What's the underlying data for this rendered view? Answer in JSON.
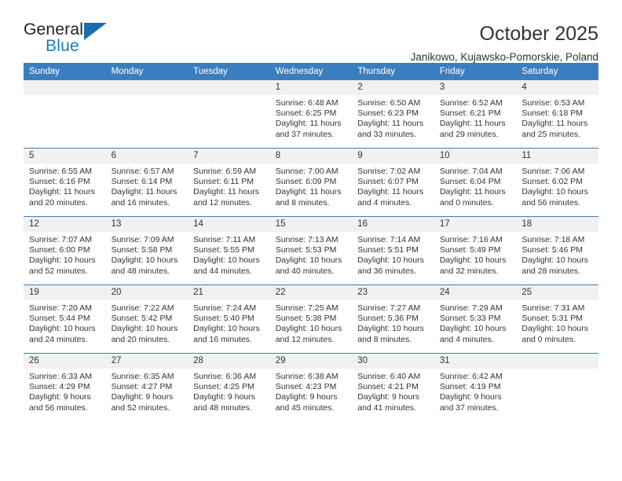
{
  "brand": {
    "name_top": "General",
    "name_bottom": "Blue",
    "accent_color": "#1b7cc4"
  },
  "header": {
    "title": "October 2025",
    "subtitle": "Janikowo, Kujawsko-Pomorskie, Poland"
  },
  "calendar": {
    "header_color": "#3b7ebf",
    "daynum_band_color": "#f1f1f1",
    "weekdays": [
      "Sunday",
      "Monday",
      "Tuesday",
      "Wednesday",
      "Thursday",
      "Friday",
      "Saturday"
    ],
    "weeks": [
      [
        {
          "day": "",
          "empty": true
        },
        {
          "day": "",
          "empty": true
        },
        {
          "day": "",
          "empty": true
        },
        {
          "day": "1",
          "sunrise": "Sunrise: 6:48 AM",
          "sunset": "Sunset: 6:25 PM",
          "daylight_line1": "Daylight: 11 hours",
          "daylight_line2": "and 37 minutes."
        },
        {
          "day": "2",
          "sunrise": "Sunrise: 6:50 AM",
          "sunset": "Sunset: 6:23 PM",
          "daylight_line1": "Daylight: 11 hours",
          "daylight_line2": "and 33 minutes."
        },
        {
          "day": "3",
          "sunrise": "Sunrise: 6:52 AM",
          "sunset": "Sunset: 6:21 PM",
          "daylight_line1": "Daylight: 11 hours",
          "daylight_line2": "and 29 minutes."
        },
        {
          "day": "4",
          "sunrise": "Sunrise: 6:53 AM",
          "sunset": "Sunset: 6:18 PM",
          "daylight_line1": "Daylight: 11 hours",
          "daylight_line2": "and 25 minutes."
        }
      ],
      [
        {
          "day": "5",
          "sunrise": "Sunrise: 6:55 AM",
          "sunset": "Sunset: 6:16 PM",
          "daylight_line1": "Daylight: 11 hours",
          "daylight_line2": "and 20 minutes."
        },
        {
          "day": "6",
          "sunrise": "Sunrise: 6:57 AM",
          "sunset": "Sunset: 6:14 PM",
          "daylight_line1": "Daylight: 11 hours",
          "daylight_line2": "and 16 minutes."
        },
        {
          "day": "7",
          "sunrise": "Sunrise: 6:59 AM",
          "sunset": "Sunset: 6:11 PM",
          "daylight_line1": "Daylight: 11 hours",
          "daylight_line2": "and 12 minutes."
        },
        {
          "day": "8",
          "sunrise": "Sunrise: 7:00 AM",
          "sunset": "Sunset: 6:09 PM",
          "daylight_line1": "Daylight: 11 hours",
          "daylight_line2": "and 8 minutes."
        },
        {
          "day": "9",
          "sunrise": "Sunrise: 7:02 AM",
          "sunset": "Sunset: 6:07 PM",
          "daylight_line1": "Daylight: 11 hours",
          "daylight_line2": "and 4 minutes."
        },
        {
          "day": "10",
          "sunrise": "Sunrise: 7:04 AM",
          "sunset": "Sunset: 6:04 PM",
          "daylight_line1": "Daylight: 11 hours",
          "daylight_line2": "and 0 minutes."
        },
        {
          "day": "11",
          "sunrise": "Sunrise: 7:06 AM",
          "sunset": "Sunset: 6:02 PM",
          "daylight_line1": "Daylight: 10 hours",
          "daylight_line2": "and 56 minutes."
        }
      ],
      [
        {
          "day": "12",
          "sunrise": "Sunrise: 7:07 AM",
          "sunset": "Sunset: 6:00 PM",
          "daylight_line1": "Daylight: 10 hours",
          "daylight_line2": "and 52 minutes."
        },
        {
          "day": "13",
          "sunrise": "Sunrise: 7:09 AM",
          "sunset": "Sunset: 5:58 PM",
          "daylight_line1": "Daylight: 10 hours",
          "daylight_line2": "and 48 minutes."
        },
        {
          "day": "14",
          "sunrise": "Sunrise: 7:11 AM",
          "sunset": "Sunset: 5:55 PM",
          "daylight_line1": "Daylight: 10 hours",
          "daylight_line2": "and 44 minutes."
        },
        {
          "day": "15",
          "sunrise": "Sunrise: 7:13 AM",
          "sunset": "Sunset: 5:53 PM",
          "daylight_line1": "Daylight: 10 hours",
          "daylight_line2": "and 40 minutes."
        },
        {
          "day": "16",
          "sunrise": "Sunrise: 7:14 AM",
          "sunset": "Sunset: 5:51 PM",
          "daylight_line1": "Daylight: 10 hours",
          "daylight_line2": "and 36 minutes."
        },
        {
          "day": "17",
          "sunrise": "Sunrise: 7:16 AM",
          "sunset": "Sunset: 5:49 PM",
          "daylight_line1": "Daylight: 10 hours",
          "daylight_line2": "and 32 minutes."
        },
        {
          "day": "18",
          "sunrise": "Sunrise: 7:18 AM",
          "sunset": "Sunset: 5:46 PM",
          "daylight_line1": "Daylight: 10 hours",
          "daylight_line2": "and 28 minutes."
        }
      ],
      [
        {
          "day": "19",
          "sunrise": "Sunrise: 7:20 AM",
          "sunset": "Sunset: 5:44 PM",
          "daylight_line1": "Daylight: 10 hours",
          "daylight_line2": "and 24 minutes."
        },
        {
          "day": "20",
          "sunrise": "Sunrise: 7:22 AM",
          "sunset": "Sunset: 5:42 PM",
          "daylight_line1": "Daylight: 10 hours",
          "daylight_line2": "and 20 minutes."
        },
        {
          "day": "21",
          "sunrise": "Sunrise: 7:24 AM",
          "sunset": "Sunset: 5:40 PM",
          "daylight_line1": "Daylight: 10 hours",
          "daylight_line2": "and 16 minutes."
        },
        {
          "day": "22",
          "sunrise": "Sunrise: 7:25 AM",
          "sunset": "Sunset: 5:38 PM",
          "daylight_line1": "Daylight: 10 hours",
          "daylight_line2": "and 12 minutes."
        },
        {
          "day": "23",
          "sunrise": "Sunrise: 7:27 AM",
          "sunset": "Sunset: 5:36 PM",
          "daylight_line1": "Daylight: 10 hours",
          "daylight_line2": "and 8 minutes."
        },
        {
          "day": "24",
          "sunrise": "Sunrise: 7:29 AM",
          "sunset": "Sunset: 5:33 PM",
          "daylight_line1": "Daylight: 10 hours",
          "daylight_line2": "and 4 minutes."
        },
        {
          "day": "25",
          "sunrise": "Sunrise: 7:31 AM",
          "sunset": "Sunset: 5:31 PM",
          "daylight_line1": "Daylight: 10 hours",
          "daylight_line2": "and 0 minutes."
        }
      ],
      [
        {
          "day": "26",
          "sunrise": "Sunrise: 6:33 AM",
          "sunset": "Sunset: 4:29 PM",
          "daylight_line1": "Daylight: 9 hours",
          "daylight_line2": "and 56 minutes."
        },
        {
          "day": "27",
          "sunrise": "Sunrise: 6:35 AM",
          "sunset": "Sunset: 4:27 PM",
          "daylight_line1": "Daylight: 9 hours",
          "daylight_line2": "and 52 minutes."
        },
        {
          "day": "28",
          "sunrise": "Sunrise: 6:36 AM",
          "sunset": "Sunset: 4:25 PM",
          "daylight_line1": "Daylight: 9 hours",
          "daylight_line2": "and 48 minutes."
        },
        {
          "day": "29",
          "sunrise": "Sunrise: 6:38 AM",
          "sunset": "Sunset: 4:23 PM",
          "daylight_line1": "Daylight: 9 hours",
          "daylight_line2": "and 45 minutes."
        },
        {
          "day": "30",
          "sunrise": "Sunrise: 6:40 AM",
          "sunset": "Sunset: 4:21 PM",
          "daylight_line1": "Daylight: 9 hours",
          "daylight_line2": "and 41 minutes."
        },
        {
          "day": "31",
          "sunrise": "Sunrise: 6:42 AM",
          "sunset": "Sunset: 4:19 PM",
          "daylight_line1": "Daylight: 9 hours",
          "daylight_line2": "and 37 minutes."
        },
        {
          "day": "",
          "empty": true
        }
      ]
    ]
  }
}
